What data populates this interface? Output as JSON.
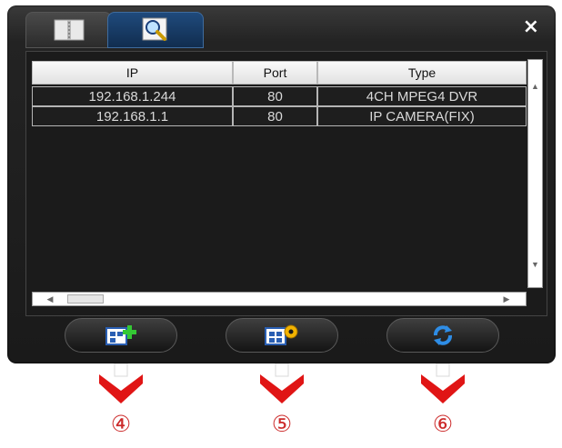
{
  "tabs": [
    {
      "name": "device-list",
      "icon": "device-list-icon"
    },
    {
      "name": "search",
      "icon": "magnifier-icon"
    }
  ],
  "close_label": "×",
  "table": {
    "headers": {
      "ip": "IP",
      "port": "Port",
      "type": "Type"
    },
    "rows": [
      {
        "ip": "192.168.1.244",
        "port": "80",
        "type": "4CH MPEG4 DVR"
      },
      {
        "ip": "192.168.1.1",
        "port": "80",
        "type": "IP CAMERA(FIX)"
      }
    ]
  },
  "buttons": [
    {
      "name": "add-device-button",
      "icon": "add-device-icon"
    },
    {
      "name": "device-settings-button",
      "icon": "settings-icon"
    },
    {
      "name": "refresh-button",
      "icon": "refresh-icon"
    }
  ],
  "callouts": [
    "④",
    "⑤",
    "⑥"
  ],
  "colors": {
    "callout_red": "#e01515",
    "accent_blue": "#1f4a7c"
  }
}
